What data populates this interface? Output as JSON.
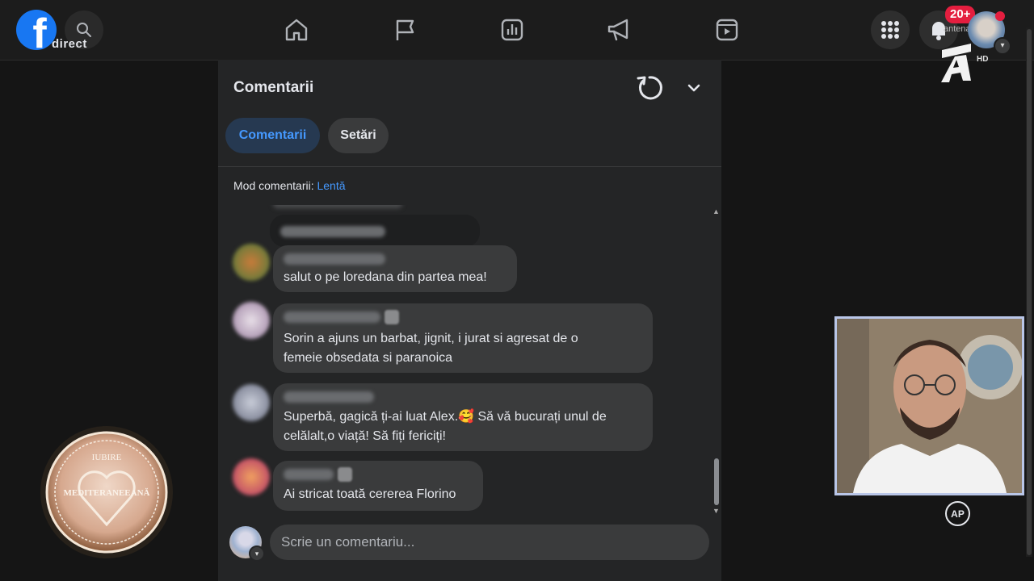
{
  "topbar": {
    "brand_label": "direct",
    "notification_count": "20+",
    "channel_tag": "antena",
    "channel_quality": "HD",
    "nav_icons": [
      "home-icon",
      "flag-icon",
      "insights-icon",
      "megaphone-icon",
      "reels-icon"
    ]
  },
  "panel": {
    "title": "Comentarii",
    "tabs": [
      {
        "label": "Comentarii",
        "active": true
      },
      {
        "label": "Setări",
        "active": false
      }
    ],
    "mode_label": "Mod comentarii:",
    "mode_value": "Lentă",
    "comments": [
      {
        "text": "salut o pe loredana din partea mea!"
      },
      {
        "lines": [
          "Sorin a ajuns un barbat, jignit, i jurat si agresat de o",
          "femeie obsedata si paranoica"
        ]
      },
      {
        "lines": [
          "Superbă, gagică ți-ai luat Alex.🥰 Să vă bucurați unul de",
          "celălalt,o viață! Să fiți fericiți!"
        ]
      },
      {
        "text": "Ai stricat toată cererea Florino"
      }
    ],
    "composer_placeholder": "Scrie un comentariu..."
  },
  "overlay": {
    "show_logo_top": "IUBIRE",
    "show_logo_main": "MEDITERANEEANĂ",
    "ap_label": "AP"
  },
  "colors": {
    "accent": "#4599ff",
    "facebook_blue": "#1877f2",
    "notification_red": "#e41e3f",
    "panel_bg": "#242526",
    "bubble_bg": "#3a3b3c"
  }
}
